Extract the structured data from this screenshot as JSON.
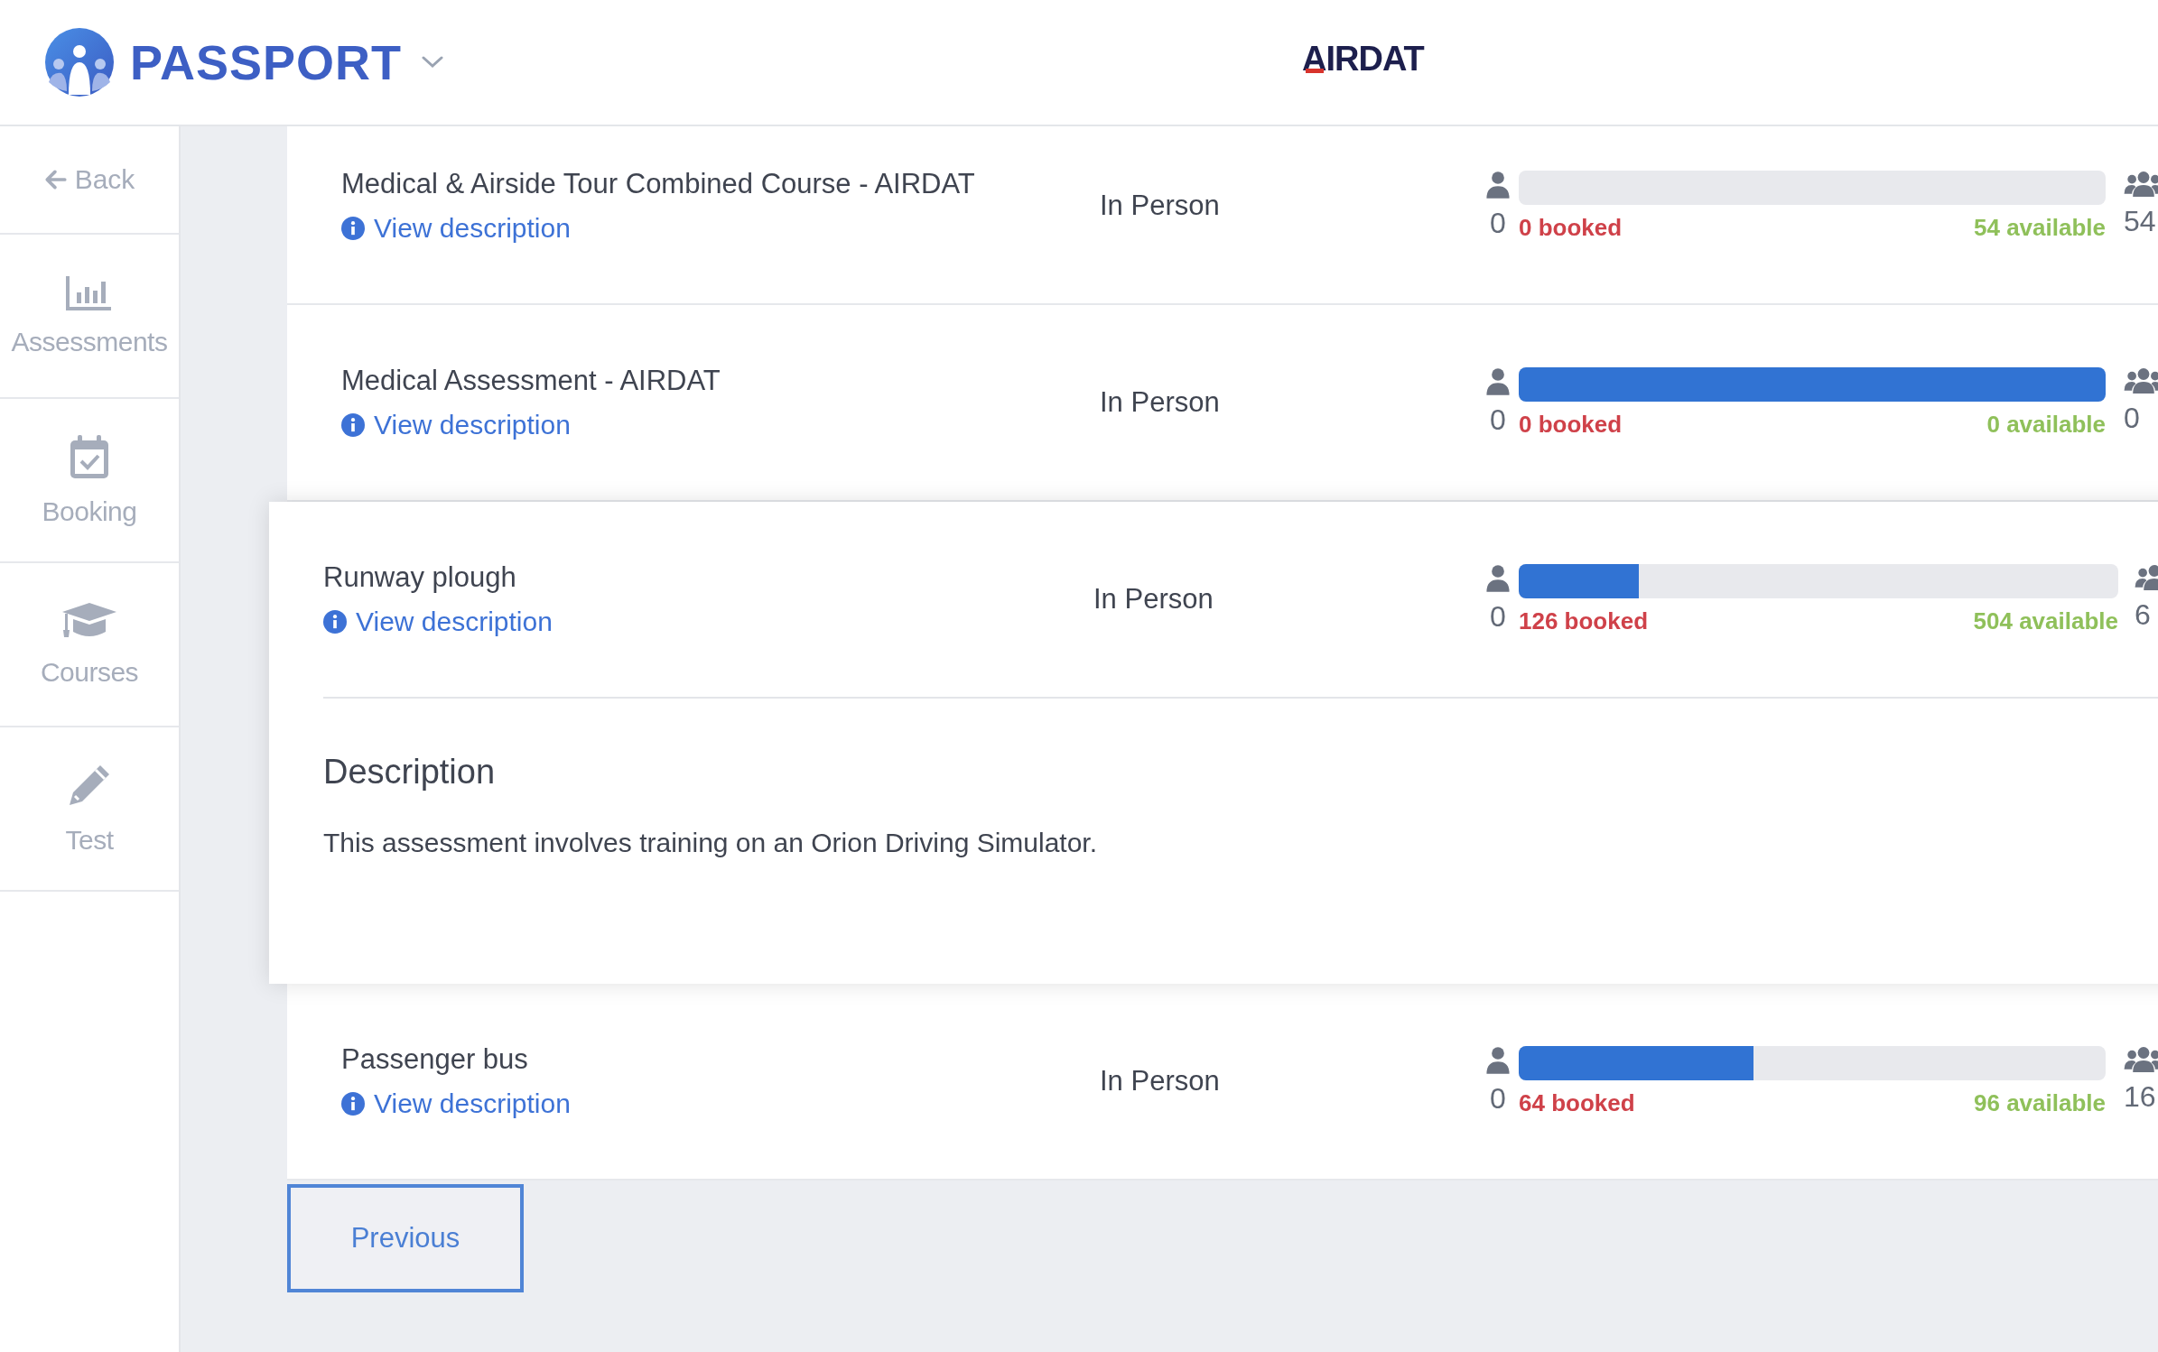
{
  "header": {
    "brand": "PASSPORT",
    "partner": "AIRDAT"
  },
  "sidebar": {
    "back": "Back",
    "items": [
      {
        "label": "Assessments",
        "kind": "chart"
      },
      {
        "label": "Booking",
        "kind": "calendar"
      },
      {
        "label": "Courses",
        "kind": "cap"
      },
      {
        "label": "Test",
        "kind": "pencil"
      }
    ]
  },
  "rows": [
    {
      "title": "Medical & Airside Tour Combined Course - AIRDAT",
      "mode": "In Person",
      "link": "View description",
      "expanded": false,
      "min": "0",
      "booked": "0 booked",
      "available": "54 available",
      "capacity": "54",
      "level": 0
    },
    {
      "title": "Medical Assessment - AIRDAT",
      "mode": "In Person",
      "link": "View description",
      "expanded": false,
      "min": "0",
      "booked": "0 booked",
      "available": "0 available",
      "capacity": "0",
      "level": 1
    },
    {
      "title": "Runway plough",
      "mode": "In Person",
      "link": "View description",
      "expanded": true,
      "min": "0",
      "booked": "126 booked",
      "available": "504 available",
      "capacity": "6",
      "level": 0.2,
      "description_heading": "Description",
      "description": "This assessment involves training on an Orion Driving Simulator."
    },
    {
      "title": "Passenger bus",
      "mode": "In Person",
      "link": "View description",
      "expanded": false,
      "min": "0",
      "booked": "64 booked",
      "available": "96 available",
      "capacity": "16",
      "level": 0.4
    }
  ],
  "pagination": {
    "previous": "Previous"
  }
}
